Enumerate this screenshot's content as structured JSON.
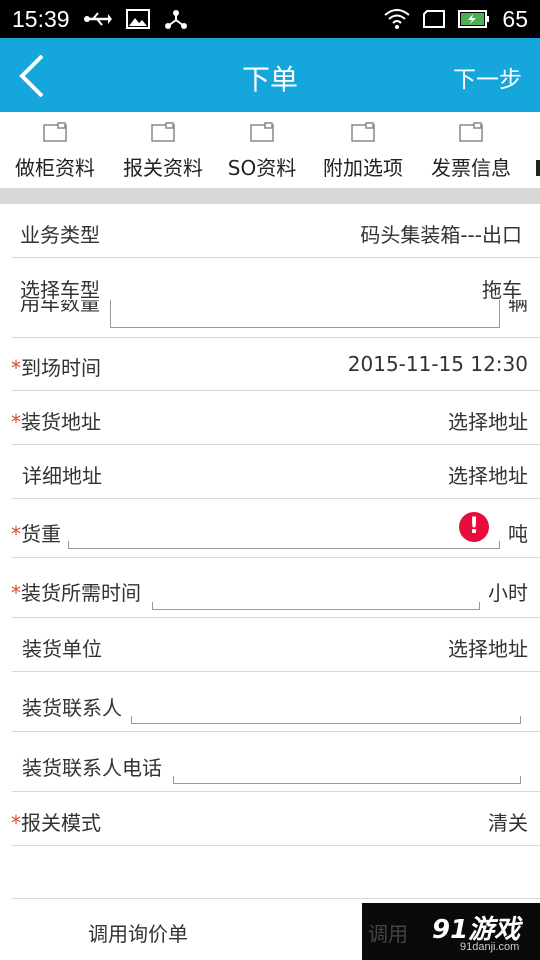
{
  "status_bar": {
    "time": "15:39",
    "battery": "65"
  },
  "header": {
    "title": "下单",
    "next_label": "下一步"
  },
  "tabs": [
    {
      "label": "做柜资料"
    },
    {
      "label": "报关资料"
    },
    {
      "label": "SO资料"
    },
    {
      "label": "附加选项"
    },
    {
      "label": "发票信息"
    }
  ],
  "form": {
    "business_type": {
      "label": "业务类型",
      "value": "码头集装箱---出口"
    },
    "vehicle_type": {
      "label": "选择车型",
      "value": "拖车"
    },
    "vehicle_count": {
      "label": "用车数量",
      "unit": "辆"
    },
    "arrival_time": {
      "required_mark": "*",
      "label": "到场时间",
      "value": "2015-11-15 12:30"
    },
    "loading_address": {
      "required_mark": "*",
      "label": "装货地址",
      "value": "选择地址"
    },
    "detail_address": {
      "label": "详细地址",
      "value": "选择地址"
    },
    "cargo_weight": {
      "required_mark": "*",
      "label": "货重",
      "unit": "吨"
    },
    "loading_time": {
      "required_mark": "*",
      "label": "装货所需时间",
      "unit": "小时"
    },
    "loading_unit": {
      "label": "装货单位",
      "value": "选择地址"
    },
    "loading_contact": {
      "label": "装货联系人"
    },
    "loading_contact_phone": {
      "label": "装货联系人电话"
    },
    "customs_mode": {
      "required_mark": "*",
      "label": "报关模式",
      "value": "清关"
    }
  },
  "bottom": {
    "inquiry_button": "调用询价单",
    "second_button_partial": "调用"
  },
  "watermark": {
    "brand": "91游戏",
    "site": "91danji.com"
  },
  "colors": {
    "app_bar": "#15a6dc",
    "required": "#e2452f",
    "error": "#e60c3c"
  }
}
